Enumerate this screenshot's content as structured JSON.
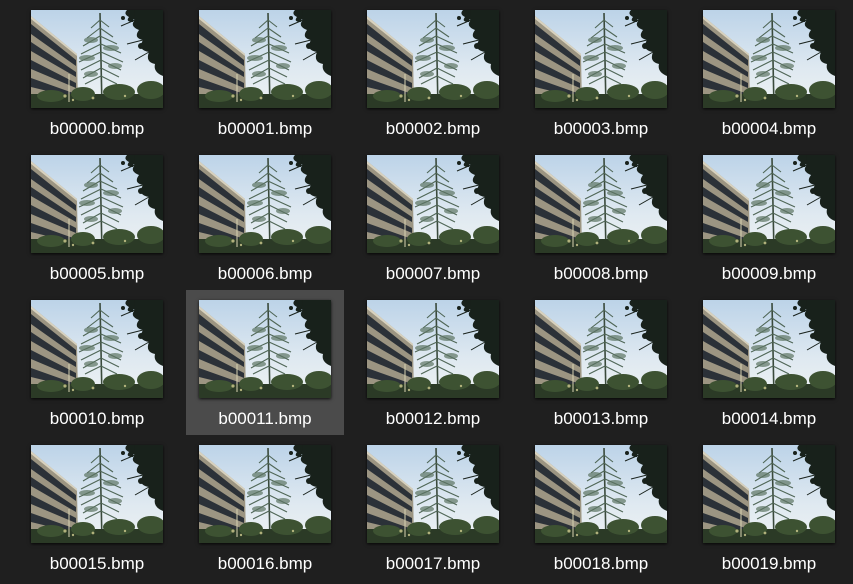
{
  "theme": {
    "background": "#1f1f1f",
    "selected_background": "#4b4b4b",
    "text": "#ffffff"
  },
  "thumbnail_icon": "photo-thumbnail-tree-building",
  "files": [
    {
      "name": "b00000.bmp",
      "selected": false
    },
    {
      "name": "b00001.bmp",
      "selected": false
    },
    {
      "name": "b00002.bmp",
      "selected": false
    },
    {
      "name": "b00003.bmp",
      "selected": false
    },
    {
      "name": "b00004.bmp",
      "selected": false
    },
    {
      "name": "b00005.bmp",
      "selected": false
    },
    {
      "name": "b00006.bmp",
      "selected": false
    },
    {
      "name": "b00007.bmp",
      "selected": false
    },
    {
      "name": "b00008.bmp",
      "selected": false
    },
    {
      "name": "b00009.bmp",
      "selected": false
    },
    {
      "name": "b00010.bmp",
      "selected": false
    },
    {
      "name": "b00011.bmp",
      "selected": true
    },
    {
      "name": "b00012.bmp",
      "selected": false
    },
    {
      "name": "b00013.bmp",
      "selected": false
    },
    {
      "name": "b00014.bmp",
      "selected": false
    },
    {
      "name": "b00015.bmp",
      "selected": false
    },
    {
      "name": "b00016.bmp",
      "selected": false
    },
    {
      "name": "b00017.bmp",
      "selected": false
    },
    {
      "name": "b00018.bmp",
      "selected": false
    },
    {
      "name": "b00019.bmp",
      "selected": false
    }
  ]
}
